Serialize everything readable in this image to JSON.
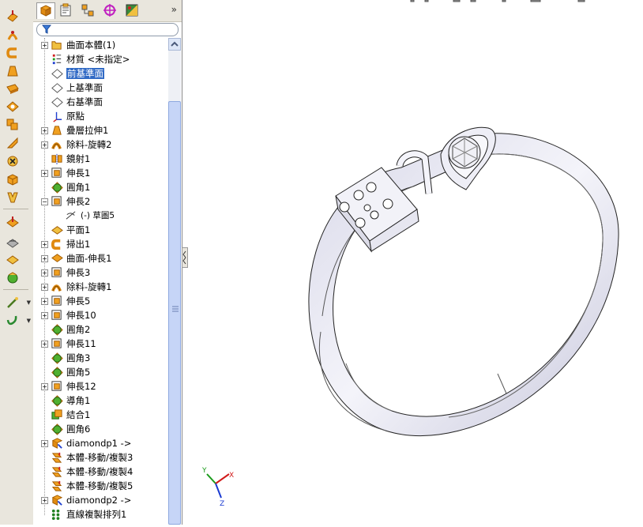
{
  "feature_tree": {
    "items": [
      {
        "label": "曲面本體(1)",
        "icon": "surface-bodies-folder-icon",
        "expandable": true
      },
      {
        "label": "材質 <未指定>",
        "icon": "material-icon",
        "expandable": false
      },
      {
        "label": "前基準面",
        "icon": "plane-icon",
        "expandable": false,
        "selected": true
      },
      {
        "label": "上基準面",
        "icon": "plane-icon",
        "expandable": false
      },
      {
        "label": "右基準面",
        "icon": "plane-icon",
        "expandable": false
      },
      {
        "label": "原點",
        "icon": "origin-icon",
        "expandable": false
      },
      {
        "label": "疊層拉伸1",
        "icon": "loft-icon",
        "expandable": true
      },
      {
        "label": "除料-旋轉2",
        "icon": "revolve-cut-icon",
        "expandable": true
      },
      {
        "label": "鏡射1",
        "icon": "mirror-icon",
        "expandable": false
      },
      {
        "label": "伸長1",
        "icon": "extrude-icon",
        "expandable": true
      },
      {
        "label": "圓角1",
        "icon": "fillet-icon",
        "expandable": false
      },
      {
        "label": "伸長2",
        "icon": "extrude-icon",
        "expandable": true,
        "expanded": true
      },
      {
        "label": "(-) 草圖5",
        "icon": "sketch-icon",
        "expandable": false,
        "child": true
      },
      {
        "label": "平面1",
        "icon": "plane-feature-icon",
        "expandable": false
      },
      {
        "label": "掃出1",
        "icon": "sweep-icon",
        "expandable": true
      },
      {
        "label": "曲面-伸長1",
        "icon": "surface-extrude-icon",
        "expandable": true
      },
      {
        "label": "伸長3",
        "icon": "extrude-icon",
        "expandable": true
      },
      {
        "label": "除料-旋轉1",
        "icon": "revolve-cut-icon",
        "expandable": true
      },
      {
        "label": "伸長5",
        "icon": "extrude-icon",
        "expandable": true
      },
      {
        "label": "伸長10",
        "icon": "extrude-icon",
        "expandable": true
      },
      {
        "label": "圓角2",
        "icon": "fillet-icon",
        "expandable": false
      },
      {
        "label": "伸長11",
        "icon": "extrude-icon",
        "expandable": true
      },
      {
        "label": "圓角3",
        "icon": "fillet-icon",
        "expandable": false
      },
      {
        "label": "圓角5",
        "icon": "fillet-icon",
        "expandable": false
      },
      {
        "label": "伸長12",
        "icon": "extrude-icon",
        "expandable": true
      },
      {
        "label": "導角1",
        "icon": "chamfer-icon",
        "expandable": false
      },
      {
        "label": "結合1",
        "icon": "combine-icon",
        "expandable": false
      },
      {
        "label": "圓角6",
        "icon": "fillet-icon",
        "expandable": false
      },
      {
        "label": "diamondp1 ->",
        "icon": "insert-part-icon",
        "expandable": true
      },
      {
        "label": "本體-移動/複製3",
        "icon": "move-copy-body-icon",
        "expandable": false
      },
      {
        "label": "本體-移動/複製4",
        "icon": "move-copy-body-icon",
        "expandable": false
      },
      {
        "label": "本體-移動/複製5",
        "icon": "move-copy-body-icon",
        "expandable": false
      },
      {
        "label": "diamondp2 ->",
        "icon": "insert-part-icon",
        "expandable": true
      },
      {
        "label": "直線複製排列1",
        "icon": "linear-pattern-icon",
        "expandable": false
      }
    ]
  },
  "tabs": [
    {
      "name": "featuremanager-tab",
      "icon": "feature-tree-icon",
      "active": true
    },
    {
      "name": "propertymanager-tab",
      "icon": "property-manager-icon"
    },
    {
      "name": "configurationmanager-tab",
      "icon": "configuration-icon"
    },
    {
      "name": "dimxpert-tab",
      "icon": "dimxpert-icon"
    },
    {
      "name": "display-manager-tab",
      "icon": "display-manager-icon"
    }
  ],
  "tabs_more": "»",
  "triad": {
    "x": "X",
    "y": "Y",
    "z": "Z"
  },
  "colors": {
    "selection": "#316ac5",
    "toolbar_bg": "#e9e6dd",
    "model_fill": "#ececf5",
    "model_edge": "#222222",
    "axis_x": "#d11a1a",
    "axis_y": "#1a9a1a",
    "axis_z": "#1a3ad1"
  }
}
